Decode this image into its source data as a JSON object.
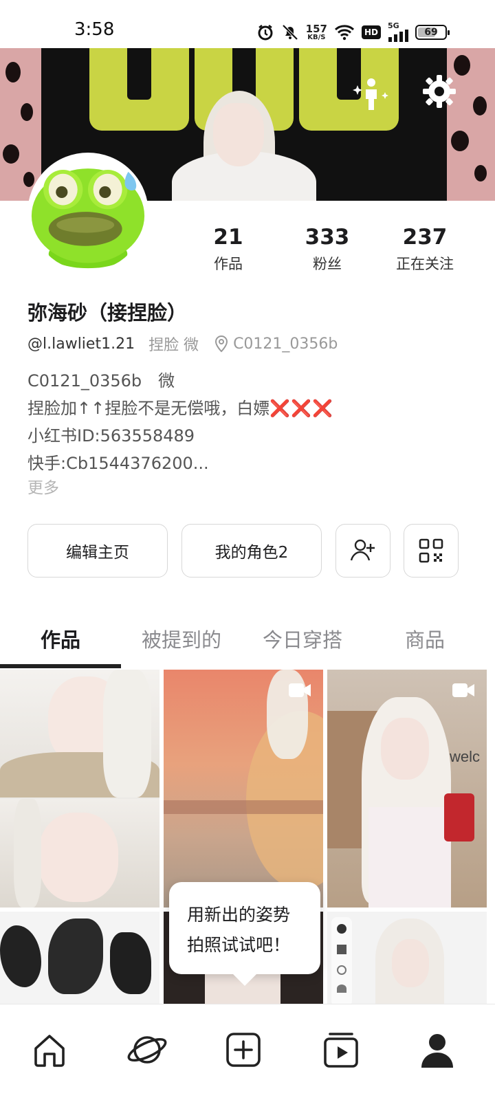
{
  "status_bar": {
    "time": "3:58",
    "net_speed": "157",
    "net_speed_unit": "KB/S",
    "hd_label": "HD",
    "network_label": "5G",
    "battery_level": 69,
    "battery_text": "69",
    "icons": [
      "alarm-icon",
      "mute-icon",
      "wifi-icon",
      "hd-icon",
      "signal-icon",
      "battery-icon"
    ]
  },
  "banner": {
    "icons": [
      "person-sparkle-icon",
      "settings-icon"
    ]
  },
  "stats": [
    {
      "value": "21",
      "label": "作品"
    },
    {
      "value": "333",
      "label": "粉丝"
    },
    {
      "value": "237",
      "label": "正在关注"
    }
  ],
  "profile": {
    "name": "弥海砂（接捏脸）",
    "handle": "@l.lawliet1.21",
    "tag": "捏脸 微",
    "location": "C0121_0356b",
    "bio": [
      "C0121_0356b　微",
      "捏脸加↑↑捏脸不是无偿哦，白嫖",
      "小红书ID:563558489",
      "快手:Cb1544376200..."
    ],
    "bio_marks": "❌❌❌",
    "more": "更多"
  },
  "actions": {
    "edit_profile": "编辑主页",
    "my_role": "我的角色2",
    "icons": [
      "add-friend-icon",
      "qr-code-icon"
    ]
  },
  "tabs": [
    {
      "label": "作品",
      "active": true
    },
    {
      "label": "被提到的",
      "active": false
    },
    {
      "label": "今日穿搭",
      "active": false
    },
    {
      "label": "商品",
      "active": false
    }
  ],
  "grid": {
    "watermark_text": "welc"
  },
  "tooltip": {
    "line1": "用新出的姿势",
    "line2": "拍照试试吧！"
  },
  "bottom_nav": [
    "home-icon",
    "planet-icon",
    "create-icon",
    "video-icon",
    "profile-icon"
  ],
  "colors": {
    "accent_banner": "#c9d444",
    "text_primary": "#1d1d1f",
    "text_secondary": "#999999",
    "bio_x": "#e02b2b"
  }
}
